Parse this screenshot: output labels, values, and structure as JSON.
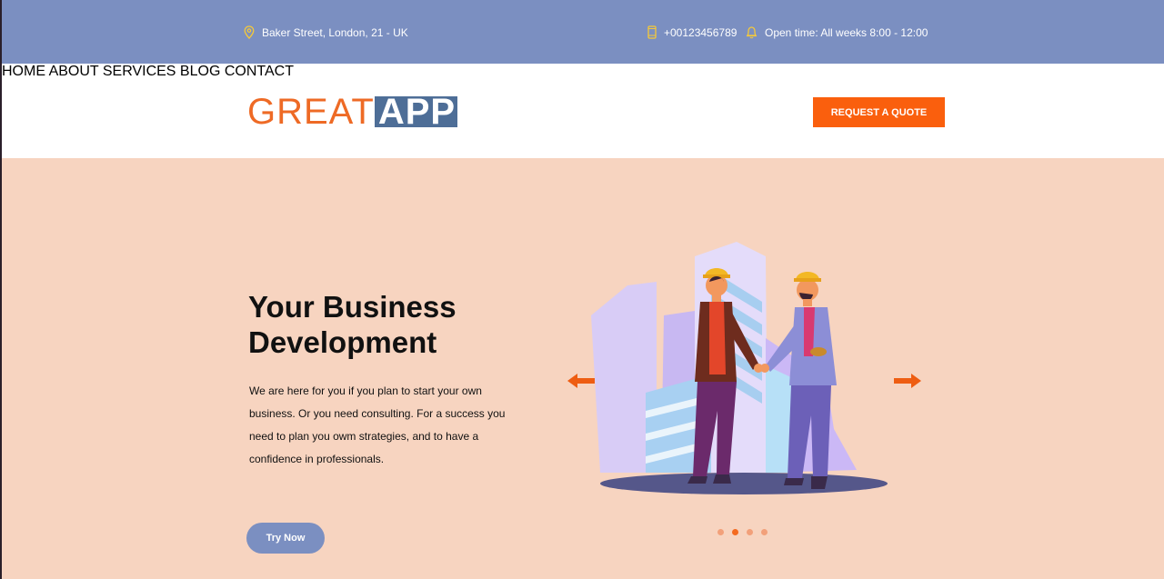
{
  "topbar": {
    "address": "Baker Street, London, 21 - UK",
    "phone": "+00123456789",
    "open_time": "Open time: All weeks 8:00 - 12:00",
    "icons": [
      "location-pin-icon",
      "phone-icon",
      "bell-icon"
    ]
  },
  "header": {
    "logo_part1": "GREAT",
    "logo_part2": "APP",
    "nav": [
      "HOME",
      "ABOUT",
      "SERVICES",
      "BLOG",
      "CONTACT"
    ],
    "cta": "REQUEST A QUOTE"
  },
  "hero": {
    "title_line1": "Your Business",
    "title_line2": "Development",
    "text": "We are here for you if you plan to start your own business. Or you need consulting. For a success you need to plan you owm strategies, and to have a confidence in professionals.",
    "button": "Try Now",
    "slides_total": 4,
    "slide_active": 2
  },
  "colors": {
    "topbar": "#7b8fc1",
    "accent": "#fa5f0d",
    "hero_bg": "#f7d4c0",
    "logo_orange": "#ee6a25",
    "logo_blue": "#4e6e97"
  }
}
